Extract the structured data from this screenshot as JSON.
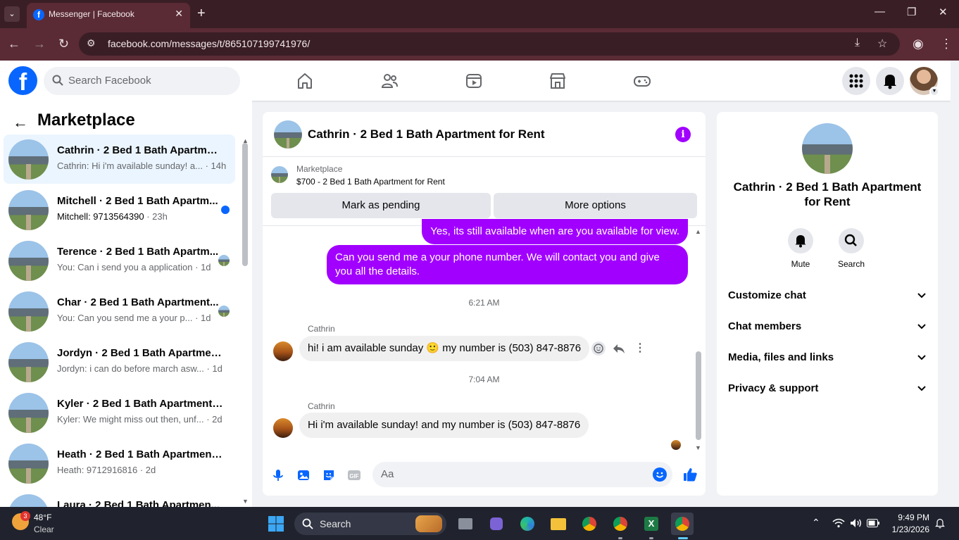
{
  "browser": {
    "tab_title": "Messenger | Facebook",
    "tab_close": "✕",
    "new_tab": "+",
    "url": "facebook.com/messages/t/865107199741976/",
    "minimize": "—",
    "restore": "❐",
    "close": "✕"
  },
  "header": {
    "search_placeholder": "Search Facebook"
  },
  "sidebar": {
    "title": "Marketplace",
    "conversations": [
      {
        "name": "Cathrin · 2 Bed 1 Bath Apartmen...",
        "preview": "Cathrin: Hi i'm available sunday! a...",
        "time": "14h",
        "active": true
      },
      {
        "name": "Mitchell · 2 Bed 1 Bath Apartm...",
        "preview": "Mitchell: 9713564390",
        "time": "23h",
        "unread": true
      },
      {
        "name": "Terence · 2 Bed 1 Bath Apartm...",
        "preview": "You: Can i send you a application",
        "time": "1d"
      },
      {
        "name": "Char · 2 Bed 1 Bath Apartment...",
        "preview": "You: Can you send me a your p...",
        "time": "1d"
      },
      {
        "name": "Jordyn · 2 Bed 1 Bath Apartment...",
        "preview": "Jordyn: i can do before march asw...",
        "time": "1d"
      },
      {
        "name": "Kyler · 2 Bed 1 Bath Apartment f...",
        "preview": "Kyler: We might miss out then, unf...",
        "time": "2d"
      },
      {
        "name": "Heath · 2 Bed 1 Bath Apartment ...",
        "preview": "Heath: 9712916816",
        "time": "2d"
      },
      {
        "name": "Laura · 2 Bed 1 Bath Apartmen...",
        "preview": "",
        "time": ""
      }
    ]
  },
  "chat": {
    "title": "Cathrin · 2 Bed 1 Bath Apartment for Rent",
    "marketplace_label": "Marketplace",
    "listing": "$700 - 2 Bed 1 Bath Apartment for Rent",
    "mark_pending": "Mark as pending",
    "more_options": "More options",
    "messages": {
      "out1": "Yes, its still available when are you available for view.",
      "out2": "Can you send me a your phone number. We will contact you and give you all the details.",
      "time1": "6:21 AM",
      "sender1": "Cathrin",
      "in1": "hi! i am available sunday 🙂 my number is (503) 847-8876",
      "time2": "7:04 AM",
      "sender2": "Cathrin",
      "in2": "Hi i'm available sunday! and my number is (503) 847-8876"
    },
    "composer_placeholder": "Aa"
  },
  "right_panel": {
    "name": "Cathrin · 2 Bed 1 Bath Apartment for Rent",
    "mute": "Mute",
    "search": "Search",
    "sections": [
      "Customize chat",
      "Chat members",
      "Media, files and links",
      "Privacy & support"
    ]
  },
  "taskbar": {
    "weather_badge": "3",
    "temp": "48°F",
    "condition": "Clear",
    "search": "Search",
    "time": "9:49 PM",
    "date": "1/23/2026"
  }
}
